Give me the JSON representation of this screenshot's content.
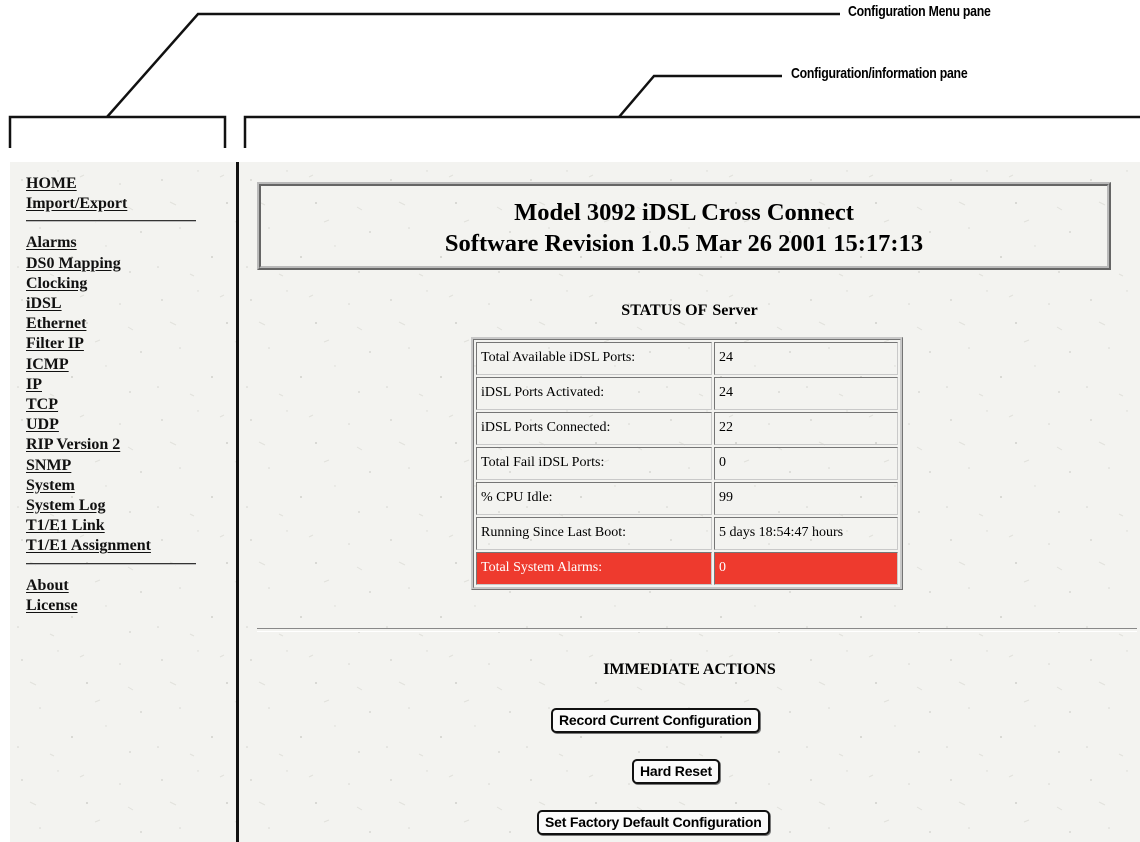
{
  "callouts": {
    "menu_pane": "Configuration Menu pane",
    "info_pane": "Configuration/information pane"
  },
  "menu": {
    "group1": [
      "HOME",
      "Import/Export"
    ],
    "group2": [
      "Alarms",
      "DS0 Mapping",
      "Clocking",
      "iDSL",
      "Ethernet",
      "Filter IP",
      "ICMP",
      "IP",
      "TCP",
      "UDP",
      "RIP Version 2",
      "SNMP",
      "System",
      "System Log",
      "T1/E1 Link",
      "T1/E1 Assignment"
    ],
    "group3": [
      "About",
      "License"
    ]
  },
  "header": {
    "title": "Model 3092 iDSL Cross Connect",
    "revision": "Software Revision 1.0.5 Mar 26 2001 15:17:13"
  },
  "status": {
    "heading": "STATUS OF",
    "server": "Server",
    "rows": [
      {
        "label": "Total Available iDSL Ports:",
        "value": "24"
      },
      {
        "label": "iDSL Ports Activated:",
        "value": "24"
      },
      {
        "label": "iDSL Ports Connected:",
        "value": "22"
      },
      {
        "label": "Total Fail iDSL Ports:",
        "value": "0"
      },
      {
        "label": "% CPU Idle:",
        "value": "99"
      },
      {
        "label": "Running Since Last Boot:",
        "value": "5 days 18:54:47 hours"
      },
      {
        "label": "Total System Alarms:",
        "value": "0"
      }
    ],
    "alarm_color": "#ee3a2e"
  },
  "actions": {
    "heading": "IMMEDIATE ACTIONS",
    "record": "Record Current Configuration",
    "reset": "Hard Reset",
    "factory": "Set Factory Default Configuration"
  }
}
